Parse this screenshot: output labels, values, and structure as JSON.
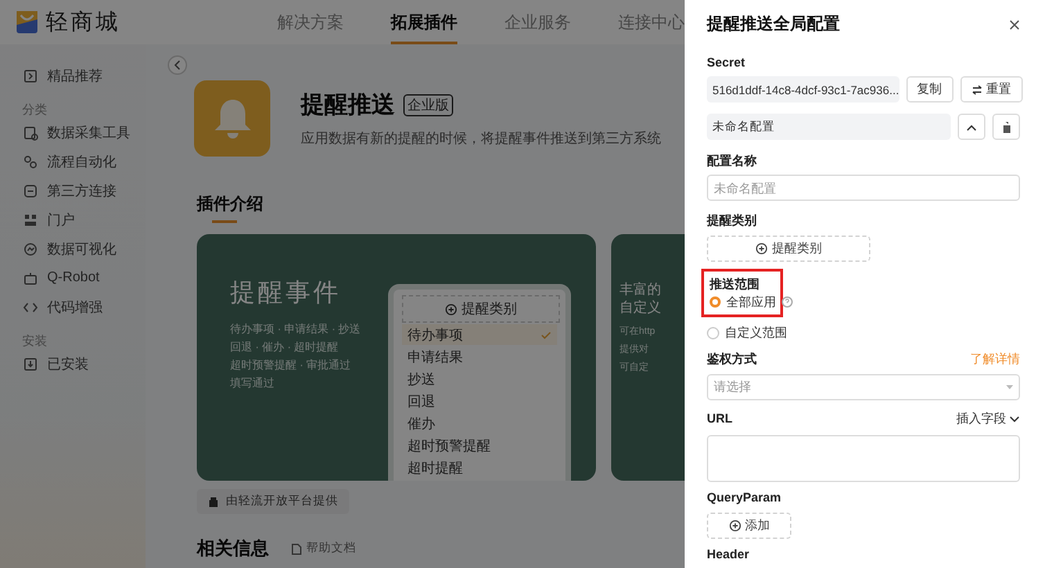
{
  "app": {
    "name": "轻商城"
  },
  "nav": [
    {
      "label": "解决方案",
      "selected": false
    },
    {
      "label": "拓展插件",
      "selected": true
    },
    {
      "label": "企业服务",
      "selected": false
    },
    {
      "label": "连接中心",
      "selected": false
    }
  ],
  "sidebar": {
    "items": [
      {
        "kind": "item",
        "label": "精品推荐"
      },
      {
        "kind": "heading",
        "label": "分类"
      },
      {
        "kind": "item",
        "label": "数据采集工具"
      },
      {
        "kind": "item",
        "label": "流程自动化"
      },
      {
        "kind": "item",
        "label": "第三方连接"
      },
      {
        "kind": "item",
        "label": "门户"
      },
      {
        "kind": "item",
        "label": "数据可视化"
      },
      {
        "kind": "item",
        "label": "Q-Robot"
      },
      {
        "kind": "item",
        "label": "代码增强"
      },
      {
        "kind": "heading",
        "label": "安装"
      },
      {
        "kind": "item",
        "label": "已安装"
      }
    ]
  },
  "plugin": {
    "title": "提醒推送",
    "edition": "企业版",
    "description": "应用数据有新的提醒的时候，将提醒事件推送到第三方系统"
  },
  "intro": {
    "heading": "插件介绍",
    "cards": [
      {
        "title": "提醒事件",
        "lines": [
          "待办事项 · 申请结果 · 抄送",
          "回退 · 催办 · 超时提醒",
          "超时预警提醒 · 审批通过",
          "填写通过"
        ],
        "panel": {
          "button": "提醒类别",
          "options": [
            {
              "label": "待办事项",
              "selected": true
            },
            {
              "label": "申请结果",
              "selected": false
            },
            {
              "label": "抄送",
              "selected": false
            },
            {
              "label": "回退",
              "selected": false
            },
            {
              "label": "催办",
              "selected": false
            },
            {
              "label": "超时预警提醒",
              "selected": false
            },
            {
              "label": "超时提醒",
              "selected": false
            }
          ]
        }
      },
      {
        "title_lines": [
          "丰富的",
          "自定义"
        ],
        "lines": [
          "可在http",
          "提供对",
          "可自定"
        ]
      }
    ]
  },
  "provider": "由轻流开放平台提供",
  "related": {
    "heading": "相关信息",
    "link": "帮助文档"
  },
  "drawer": {
    "title": "提醒推送全局配置",
    "secret": {
      "label": "Secret",
      "value": "516d1ddf-14c8-4dcf-93c1-7ac936...",
      "copy": "复制",
      "reset": "重置"
    },
    "config": {
      "name": "未命名配置",
      "expanded": true
    },
    "name_field": {
      "label": "配置名称",
      "placeholder": "未命名配置"
    },
    "category": {
      "label": "提醒类别",
      "button": "提醒类别"
    },
    "scope": {
      "label": "推送范围",
      "highlighted": true,
      "options": [
        {
          "label": "全部应用",
          "selected": true,
          "help": true
        },
        {
          "label": "自定义范围",
          "selected": false,
          "help": false
        }
      ]
    },
    "auth": {
      "label": "鉴权方式",
      "link": "了解详情",
      "placeholder": "请选择"
    },
    "url": {
      "label": "URL",
      "insert": "插入字段"
    },
    "query": {
      "label": "QueryParam",
      "button": "添加"
    },
    "header": {
      "label": "Header"
    }
  }
}
